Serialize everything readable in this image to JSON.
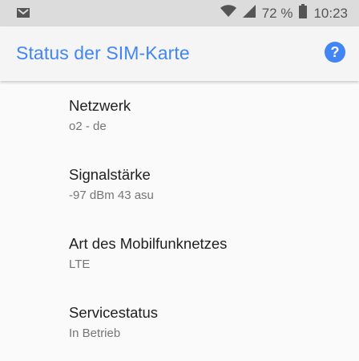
{
  "status_bar": {
    "notification_icon": "gmail-icon",
    "battery_text": "72 %",
    "time": "10:23"
  },
  "app_bar": {
    "title": "Status der SIM-Karte",
    "help_icon": "help-icon"
  },
  "items": [
    {
      "label": "Netzwerk",
      "value": "o2 - de"
    },
    {
      "label": "Signalstärke",
      "value": "-97 dBm 43 asu"
    },
    {
      "label": "Art des Mobilfunknetzes",
      "value": "LTE"
    },
    {
      "label": "Servicestatus",
      "value": "In Betrieb"
    }
  ],
  "colors": {
    "accent": "#4285f4",
    "primary_text": "#212121",
    "secondary_text": "#757575"
  }
}
